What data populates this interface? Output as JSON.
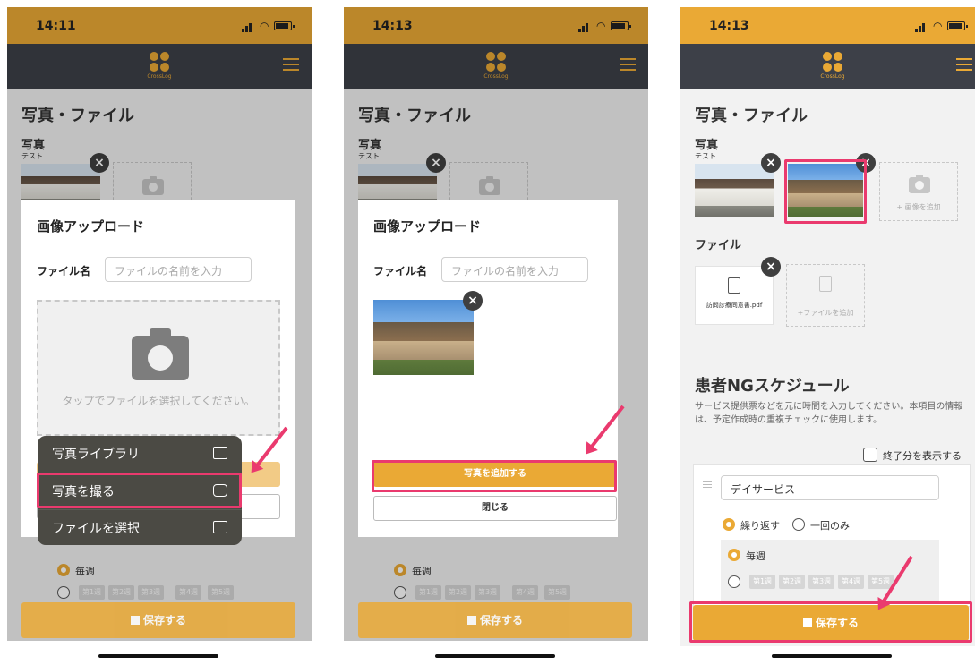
{
  "screens": [
    {
      "status": {
        "time": "14:11"
      },
      "logo_text": "CrossLog",
      "section_title": "写真・ファイル",
      "photo_label": "写真",
      "photo_caption": "テスト",
      "modal": {
        "title": "画像アップロード",
        "file_name_label": "ファイル名",
        "file_name_placeholder": "ファイルの名前を入力",
        "dropzone_text": "タップでファイルを選択してください。"
      },
      "context_menu": [
        {
          "label": "写真ライブラリ",
          "icon": "photo-library-icon"
        },
        {
          "label": "写真を撮る",
          "icon": "camera-icon"
        },
        {
          "label": "ファイルを選択",
          "icon": "folder-icon"
        }
      ],
      "radio_weekly": "毎週",
      "weeks": [
        "第1週",
        "第2週",
        "第3週",
        "第4週",
        "第5週"
      ],
      "save_label": "保存する"
    },
    {
      "status": {
        "time": "14:13"
      },
      "logo_text": "CrossLog",
      "section_title": "写真・ファイル",
      "photo_label": "写真",
      "photo_caption": "テスト",
      "modal": {
        "title": "画像アップロード",
        "file_name_label": "ファイル名",
        "file_name_placeholder": "ファイルの名前を入力",
        "add_photo_label": "写真を追加する",
        "close_label": "閉じる"
      },
      "radio_weekly": "毎週",
      "weeks": [
        "第1週",
        "第2週",
        "第3週",
        "第4週",
        "第5週"
      ],
      "save_label": "保存する"
    },
    {
      "status": {
        "time": "14:13"
      },
      "logo_text": "CrossLog",
      "section_title": "写真・ファイル",
      "photo_label": "写真",
      "photo_caption": "テスト",
      "add_image_label": "+ 画像を追加",
      "file_label": "ファイル",
      "file_name": "訪問診療同意書.pdf",
      "add_file_label": "+ファイルを追加",
      "ng_title": "患者NGスケジュール",
      "ng_desc": "サービス提供票などを元に時間を入力してください。本項目の情報は、予定作成時の重複チェックに使用します。",
      "show_end_label": "終了分を表示する",
      "service_value": "デイサービス",
      "repeat_label": "繰り返す",
      "once_label": "一回のみ",
      "radio_weekly": "毎週",
      "weeks": [
        "第1週",
        "第2週",
        "第3週",
        "第4週",
        "第5週"
      ],
      "save_label": "保存する"
    }
  ],
  "colors": {
    "accent": "#eaa935",
    "header": "#3d4048",
    "highlight": "#ea3a6e"
  }
}
